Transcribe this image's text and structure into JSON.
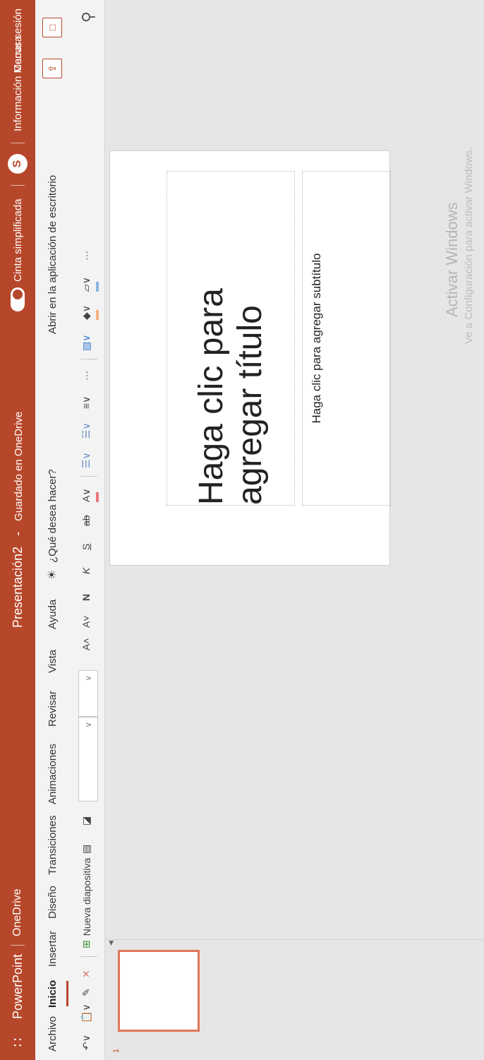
{
  "titlebar": {
    "app": "PowerPoint",
    "onedrive": "OneDrive",
    "document": "Presentación2",
    "dash": "-",
    "saved": "Guardado en OneDrive",
    "simplified": "Cinta simplificada",
    "skype": "S",
    "user_info": "Información Macusa",
    "logout": "Cerrar sesión"
  },
  "menu": {
    "tabs": [
      "Archivo",
      "Inicio",
      "Insertar",
      "Diseño",
      "Transiciones",
      "Animaciones",
      "Revisar",
      "Vista",
      "Ayuda"
    ],
    "active_tab": "Inicio",
    "tell_me": "¿Qué desea hacer?",
    "open_desktop": "Abrir en la aplicación de escritorio"
  },
  "toolbar": {
    "new_slide": "Nueva diapositiva",
    "font_grow": "A˄",
    "font_shrink": "A˅",
    "bold": "N",
    "italic": "K",
    "underline": "S",
    "strike": "ab",
    "more": "···",
    "colors": {
      "font": "#e8787a",
      "fill": "#f4b183",
      "line": "#8fb4e3"
    }
  },
  "slide_panel": {
    "number": "1"
  },
  "slide": {
    "title_placeholder": "Haga clic para agregar título",
    "subtitle_placeholder": "Haga clic para agregar subtítulo"
  },
  "watermark": {
    "line1": "Activar Windows",
    "line2": "Ve a Configuración para activar Windows."
  },
  "colors": {
    "accent": "#b7472a"
  }
}
